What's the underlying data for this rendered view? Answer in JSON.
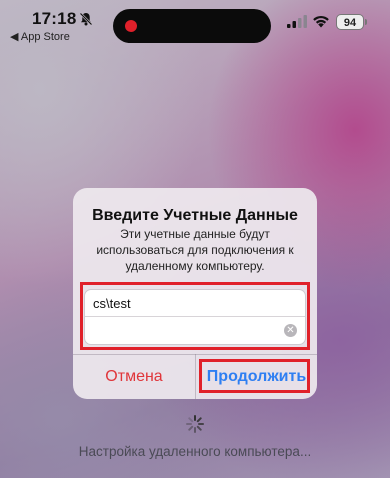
{
  "status_bar": {
    "time": "17:18",
    "back_app": "◀ App Store",
    "battery": "94",
    "icons": [
      "bell-slash-icon",
      "signal-icon",
      "wifi-icon",
      "battery-icon"
    ],
    "recording_color": "#e0202a"
  },
  "dialog": {
    "title": "Введите Учетные Данные",
    "message": "Эти учетные данные будут использоваться для подключения к удаленному компьютеру.",
    "username_value": "cs\\test",
    "password_value": "",
    "cancel_label": "Отмена",
    "continue_label": "Продолжить"
  },
  "status_text": "Настройка удаленного компьютера...",
  "colors": {
    "cancel": "#e0353a",
    "continue": "#2f7ff2",
    "highlight": "#e0202a"
  }
}
